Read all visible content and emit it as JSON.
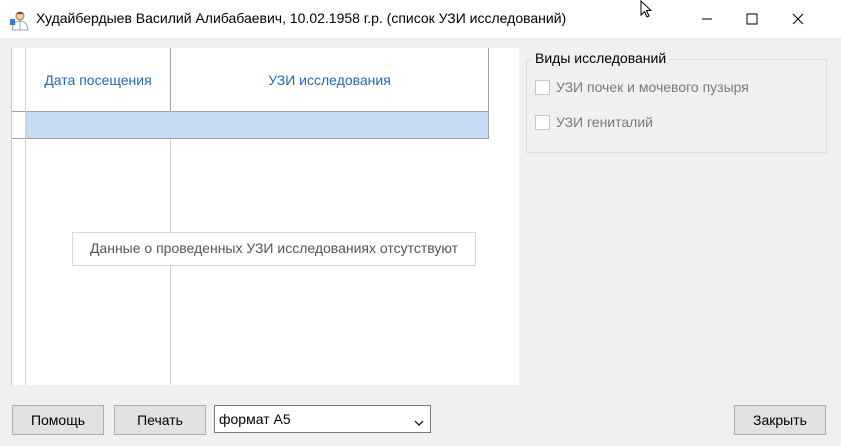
{
  "window": {
    "title": "Худайбердыев Василий Алибабаевич, 10.02.1958 г.р. (список УЗИ исследований)"
  },
  "grid": {
    "columns": [
      "Дата посещения",
      "УЗИ исследования"
    ],
    "empty_message": "Данные о проведенных УЗИ исследованиях отсутствуют"
  },
  "types_group": {
    "title": "Виды исследований",
    "items": [
      {
        "label": "УЗИ почек и мочевого пузыря",
        "checked": false
      },
      {
        "label": "УЗИ гениталий",
        "checked": false
      }
    ]
  },
  "footer": {
    "help_label": "Помощь",
    "print_label": "Печать",
    "format_value": "формат А5",
    "close_label": "Закрыть"
  }
}
